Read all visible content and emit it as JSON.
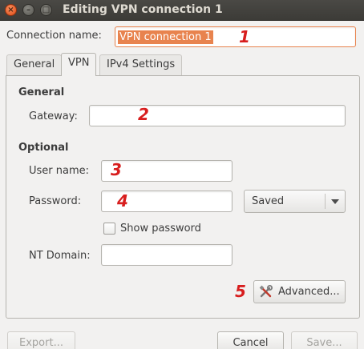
{
  "window": {
    "title": "Editing VPN connection 1",
    "close_glyph": "×",
    "min_glyph": "–",
    "max_glyph": "□"
  },
  "connection": {
    "label": "Connection name:",
    "value": "VPN connection 1"
  },
  "tabs": [
    {
      "label": "General",
      "active": false
    },
    {
      "label": "VPN",
      "active": true
    },
    {
      "label": "IPv4 Settings",
      "active": false
    }
  ],
  "general_section": {
    "heading": "General",
    "gateway_label": "Gateway:",
    "gateway_value": ""
  },
  "optional_section": {
    "heading": "Optional",
    "username_label": "User name:",
    "username_value": "",
    "password_label": "Password:",
    "password_value": "",
    "password_storage": "Saved",
    "show_password_label": "Show password",
    "show_password_checked": false,
    "nt_domain_label": "NT Domain:",
    "nt_domain_value": ""
  },
  "buttons": {
    "advanced": "Advanced...",
    "export": "Export...",
    "cancel": "Cancel",
    "save": "Save..."
  },
  "annotations": {
    "n1": "1",
    "n2": "2",
    "n3": "3",
    "n4": "4",
    "n5": "5"
  },
  "icons": {
    "advanced": "tools-icon"
  },
  "colors": {
    "titlebar": "#3c3b37",
    "selection": "#e8834e",
    "annotation": "#d81e1e"
  }
}
